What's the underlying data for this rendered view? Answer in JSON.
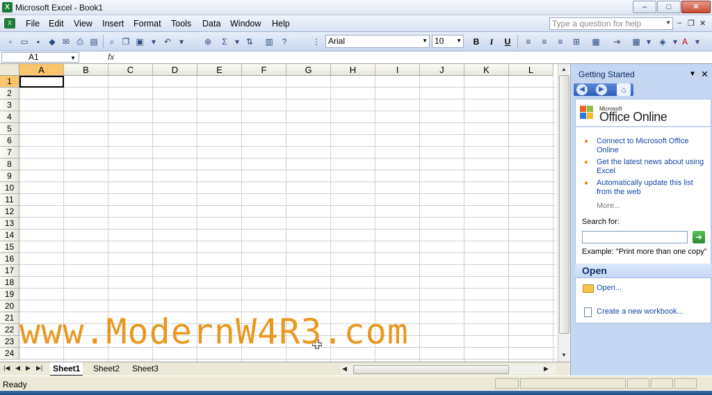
{
  "window": {
    "title": "Microsoft Excel - Book1",
    "minimize": "–",
    "maximize": "□",
    "close": "✕"
  },
  "menu": {
    "items": [
      "File",
      "Edit",
      "View",
      "Insert",
      "Format",
      "Tools",
      "Data",
      "Window",
      "Help"
    ],
    "help_placeholder": "Type a question for help",
    "doc_min": "–",
    "doc_restore": "❐",
    "doc_close": "✕"
  },
  "format": {
    "font": "Arial",
    "size": "10",
    "bold": "B",
    "italic": "I",
    "underline": "U"
  },
  "formula": {
    "cell_ref": "A1",
    "fx": "fx"
  },
  "grid": {
    "columns": [
      "A",
      "B",
      "C",
      "D",
      "E",
      "F",
      "G",
      "H",
      "I",
      "J",
      "K",
      "L"
    ],
    "rows": [
      "1",
      "2",
      "3",
      "4",
      "5",
      "6",
      "7",
      "8",
      "9",
      "10",
      "11",
      "12",
      "13",
      "14",
      "15",
      "16",
      "17",
      "18",
      "19",
      "20",
      "21",
      "22",
      "23",
      "24"
    ],
    "selected_cell": "A1"
  },
  "watermark": "www.ModernW4R3.com",
  "sheets": {
    "tabs": [
      "Sheet1",
      "Sheet2",
      "Sheet3"
    ],
    "active": "Sheet1"
  },
  "status": {
    "text": "Ready"
  },
  "task_pane": {
    "title": "Getting Started",
    "logo_small": "Microsoft",
    "logo": "Office Online",
    "links": [
      "Connect to Microsoft Office Online",
      "Get the latest news about using Excel",
      "Automatically update this list from the web"
    ],
    "more": "More...",
    "search_label": "Search for:",
    "search_go": "➔",
    "example": "Example:  \"Print more than one copy\"",
    "open_heading": "Open",
    "open_link": "Open...",
    "new_link": "Create a new workbook..."
  },
  "colors": {
    "accent": "#c4d6f2",
    "selection": "#f9c66b",
    "watermark": "#e9981f"
  }
}
